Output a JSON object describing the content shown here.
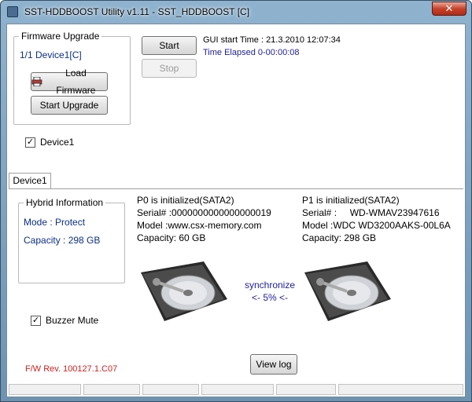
{
  "window": {
    "title": "SST-HDDBOOST Utility v1.11 - SST_HDDBOOST [C]",
    "close_icon": "close-icon"
  },
  "firmware": {
    "group_title": "Firmware Upgrade",
    "device_label": "1/1 Device1[C]",
    "load_button": "Load Firmware",
    "upgrade_button": "Start Upgrade"
  },
  "controls": {
    "start_button": "Start",
    "stop_button": "Stop"
  },
  "timing": {
    "gui_start": "GUI start Time : 21.3.2010 12:07:34",
    "elapsed": "Time Elapsed 0-00:00:08"
  },
  "device_checkbox": {
    "label": "Device1",
    "checked": true
  },
  "tab": {
    "label": "Device1"
  },
  "hybrid": {
    "group_title": "Hybrid Information",
    "mode": "Mode : Protect",
    "capacity": "Capacity : 298 GB"
  },
  "p0": {
    "status": "P0 is initialized(SATA2)",
    "serial": "Serial# :0000000000000000019",
    "model": "Model :www.csx-memory.com",
    "capacity": "Capacity: 60 GB"
  },
  "p1": {
    "status": "P1 is initialized(SATA2)",
    "serial": "Serial# :     WD-WMAV23947616",
    "model": "Model :WDC WD3200AAKS-00L6A",
    "capacity": "Capacity: 298 GB"
  },
  "sync": {
    "label": "synchronize",
    "progress": "<- 5% <-"
  },
  "buzzer": {
    "label": "Buzzer Mute",
    "checked": true
  },
  "fw_rev": "F/W Rev. 100127.1.C07",
  "view_log_button": "View log",
  "colors": {
    "navy_text": "#0b2f8a",
    "red_text": "#d42020"
  }
}
